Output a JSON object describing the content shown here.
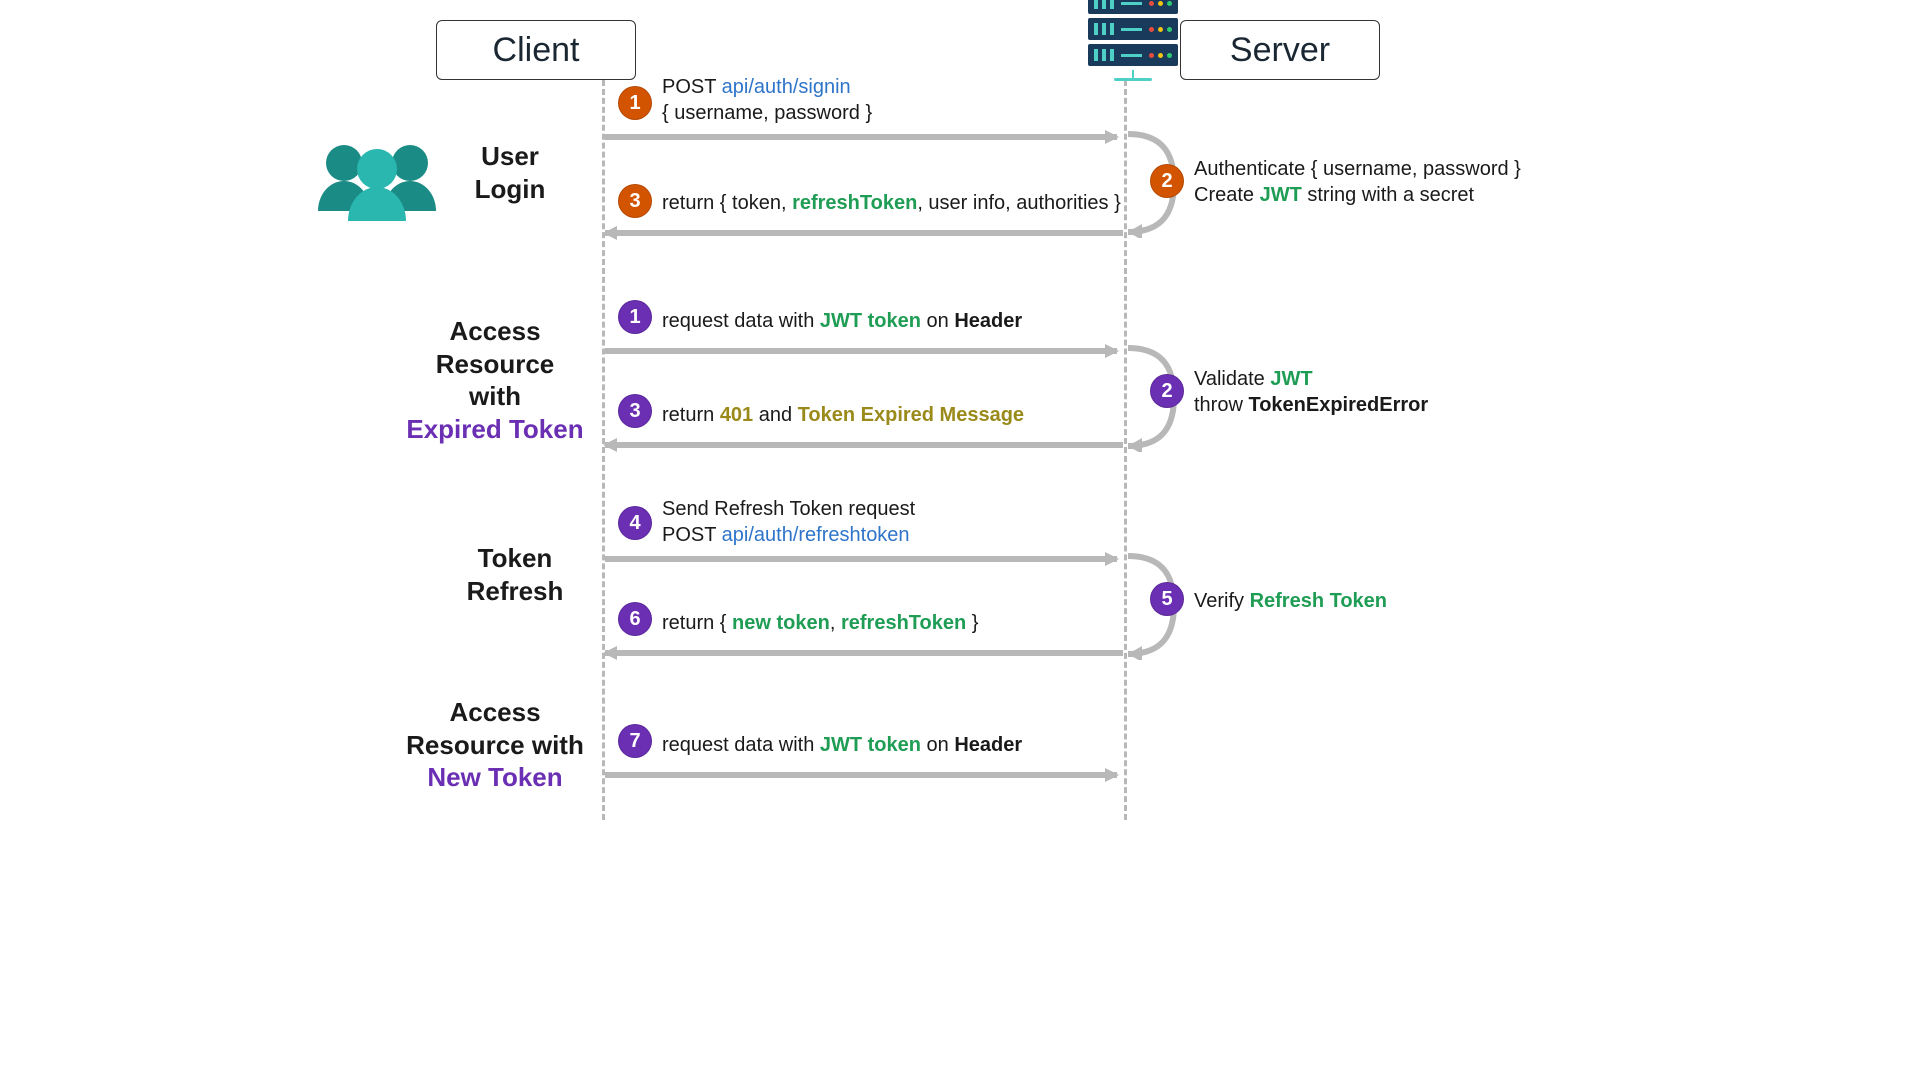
{
  "headers": {
    "client": "Client",
    "server": "Server"
  },
  "sections": {
    "login": {
      "line1": "User",
      "line2": "Login"
    },
    "expired": {
      "line1": "Access",
      "line2": "Resource",
      "line3": "with",
      "line4": "Expired Token"
    },
    "refresh": {
      "line1": "Token",
      "line2": "Refresh"
    },
    "newtoken": {
      "line1": "Access",
      "line2": "Resource with",
      "line3": "New Token"
    }
  },
  "steps": {
    "s1_prefix": "POST ",
    "s1_api": "api/auth/signin",
    "s1_body": "{ username, password }",
    "s2_line1_a": "Authenticate { username, password }",
    "s2_line2_a": "Create ",
    "s2_line2_jwt": "JWT",
    "s2_line2_b": " string with a secret",
    "s3_a": "return { token, ",
    "s3_refresh": "refreshToken",
    "s3_b": ", user info, authorities }",
    "a1_a": "request data with ",
    "a1_jwt": "JWT token",
    "a1_b": " on ",
    "a1_hdr": "Header",
    "a2_a": "Validate ",
    "a2_jwt": "JWT",
    "a2_line2_a": "throw ",
    "a2_err": "TokenExpiredError",
    "a3_a": "return ",
    "a3_401": "401",
    "a3_b": " and ",
    "a3_msg": "Token Expired Message",
    "r4_line1": "Send Refresh Token request",
    "r4_prefix": "POST ",
    "r4_api": "api/auth/refreshtoken",
    "r5_a": "Verify ",
    "r5_rt": "Refresh Token",
    "r6_a": "return { ",
    "r6_tok": "new token",
    "r6_b": ", ",
    "r6_rt": "refreshToken",
    "r6_c": " }",
    "n7_a": "request data with ",
    "n7_jwt": "JWT token",
    "n7_b": " on ",
    "n7_hdr": "Header"
  },
  "numbers": {
    "n1": "1",
    "n2": "2",
    "n3": "3",
    "a1": "1",
    "a2": "2",
    "a3": "3",
    "r4": "4",
    "r5": "5",
    "r6": "6",
    "n7": "7"
  },
  "colors": {
    "orange": "#d35400",
    "purple": "#6b2fb3",
    "green": "#1f9d55",
    "blue": "#2e74c9",
    "olive": "#9a8a1a",
    "grey": "#b8b8b8",
    "tealDark": "#1a8c85",
    "tealLight": "#2ab7b0",
    "serverBody": "#1a3a5c"
  }
}
